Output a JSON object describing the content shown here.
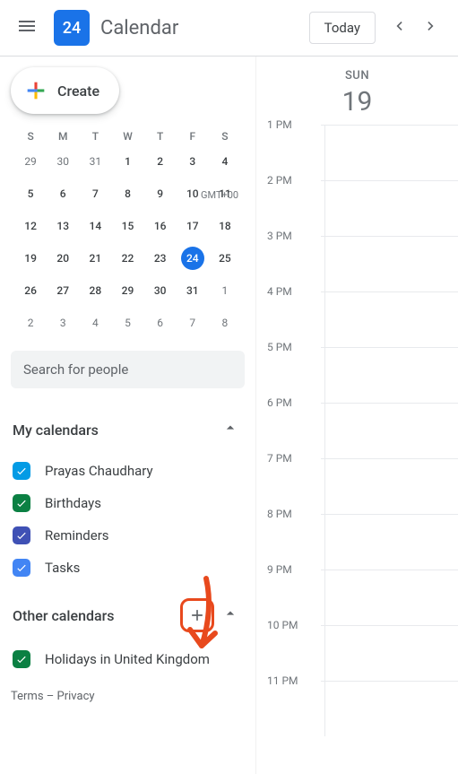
{
  "header": {
    "logo_day": "24",
    "app_title": "Calendar",
    "today_label": "Today"
  },
  "day": {
    "dow": "SUN",
    "num": "19",
    "tz": "GMT+00"
  },
  "mini_cal": {
    "dow": [
      "S",
      "M",
      "T",
      "W",
      "T",
      "F",
      "S"
    ],
    "weeks": [
      [
        {
          "n": "29",
          "out": true
        },
        {
          "n": "30",
          "out": true
        },
        {
          "n": "31",
          "out": true
        },
        {
          "n": "1"
        },
        {
          "n": "2"
        },
        {
          "n": "3"
        },
        {
          "n": "4"
        }
      ],
      [
        {
          "n": "5"
        },
        {
          "n": "6"
        },
        {
          "n": "7"
        },
        {
          "n": "8"
        },
        {
          "n": "9"
        },
        {
          "n": "10"
        },
        {
          "n": "11"
        }
      ],
      [
        {
          "n": "12"
        },
        {
          "n": "13"
        },
        {
          "n": "14"
        },
        {
          "n": "15"
        },
        {
          "n": "16"
        },
        {
          "n": "17"
        },
        {
          "n": "18"
        }
      ],
      [
        {
          "n": "19"
        },
        {
          "n": "20"
        },
        {
          "n": "21"
        },
        {
          "n": "22"
        },
        {
          "n": "23"
        },
        {
          "n": "24",
          "today": true
        },
        {
          "n": "25"
        }
      ],
      [
        {
          "n": "26"
        },
        {
          "n": "27"
        },
        {
          "n": "28"
        },
        {
          "n": "29"
        },
        {
          "n": "30"
        },
        {
          "n": "31"
        },
        {
          "n": "1",
          "out": true
        }
      ],
      [
        {
          "n": "2",
          "out": true
        },
        {
          "n": "3",
          "out": true
        },
        {
          "n": "4",
          "out": true
        },
        {
          "n": "5",
          "out": true
        },
        {
          "n": "6",
          "out": true
        },
        {
          "n": "7",
          "out": true
        },
        {
          "n": "8",
          "out": true
        }
      ]
    ]
  },
  "create_label": "Create",
  "search_placeholder": "Search for people",
  "sections": {
    "my": {
      "title": "My calendars",
      "items": [
        {
          "label": "Prayas Chaudhary",
          "color": "#039be5"
        },
        {
          "label": "Birthdays",
          "color": "#0b8043"
        },
        {
          "label": "Reminders",
          "color": "#3f51b5"
        },
        {
          "label": "Tasks",
          "color": "#4285f4"
        }
      ]
    },
    "other": {
      "title": "Other calendars",
      "items": [
        {
          "label": "Holidays in United Kingdom",
          "color": "#0b8043"
        }
      ]
    }
  },
  "time_labels": [
    "1 PM",
    "2 PM",
    "3 PM",
    "4 PM",
    "5 PM",
    "6 PM",
    "7 PM",
    "8 PM",
    "9 PM",
    "10 PM",
    "11 PM"
  ],
  "footer": {
    "terms": "Terms",
    "privacy": "Privacy",
    "sep": " – "
  }
}
